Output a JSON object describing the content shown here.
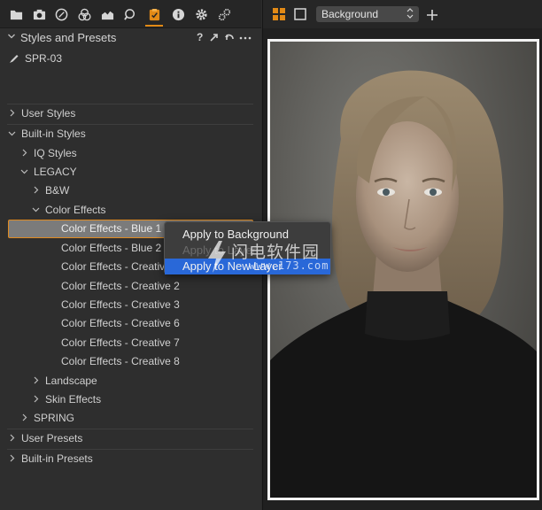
{
  "toolbar": {
    "tools": [
      "folder-icon",
      "camera-icon",
      "lens-icon",
      "color-icon",
      "exposure-icon",
      "details-icon",
      "styles-icon",
      "metadata-icon",
      "settings-icon",
      "batch-icon"
    ],
    "active_tool": "styles-icon"
  },
  "panel": {
    "title": "Styles and Presets",
    "help": "?",
    "current_style": "SPR-03"
  },
  "tree": {
    "user_styles": "User Styles",
    "builtin_styles": "Built-in Styles",
    "iq_styles": "IQ Styles",
    "legacy": "LEGACY",
    "bw": "B&W",
    "color_effects": "Color Effects",
    "items": [
      "Color Effects - Blue 1",
      "Color Effects - Blue 2",
      "Color Effects - Creative 1",
      "Color Effects - Creative 2",
      "Color Effects - Creative 3",
      "Color Effects - Creative 6",
      "Color Effects - Creative 7",
      "Color Effects - Creative 8"
    ],
    "landscape": "Landscape",
    "skin_effects": "Skin Effects",
    "spring": "SPRING",
    "user_presets": "User Presets",
    "builtin_presets": "Built-in Presets"
  },
  "context_menu": {
    "apply_background": "Apply to Background",
    "apply_hidden": "Apply to Layer",
    "apply_new_layer": "Apply to New Layer"
  },
  "watermark": {
    "text": "闪电软件园",
    "url": "www.173.com"
  },
  "viewer": {
    "layer_select": "Background"
  },
  "colors": {
    "accent": "#e28a16",
    "selection_blue": "#2968d8",
    "selected_row": "#7b7b7b"
  }
}
